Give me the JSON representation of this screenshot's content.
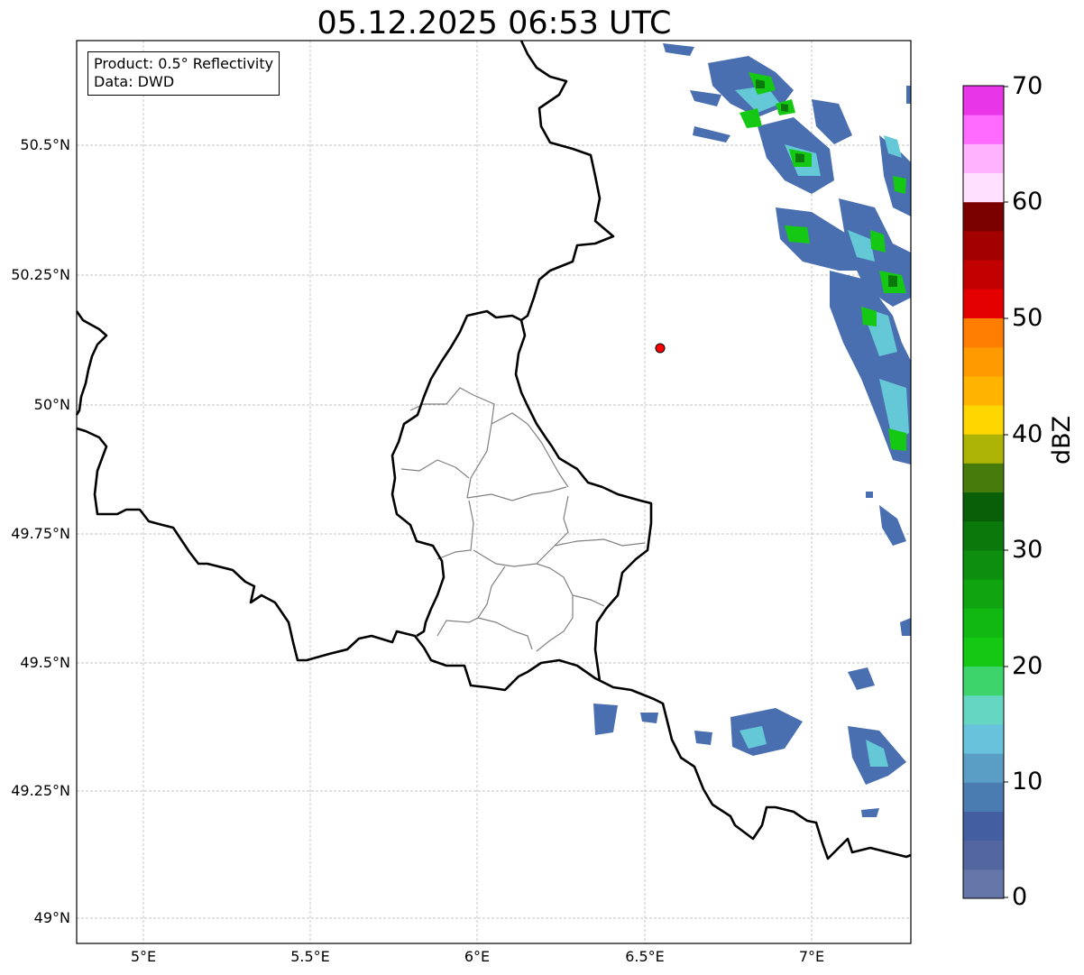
{
  "title": "05.12.2025 06:53 UTC",
  "info": {
    "product": "Product: 0.5° Reflectivity",
    "data_source": "Data: DWD"
  },
  "map": {
    "lon_range": [
      4.8,
      7.3
    ],
    "lat_range": [
      48.95,
      50.7
    ],
    "lat_ticks": [
      "50.5°N",
      "50.25°N",
      "50°N",
      "49.75°N",
      "49.5°N",
      "49.25°N",
      "49°N"
    ],
    "lon_ticks": [
      "5°E",
      "5.5°E",
      "6°E",
      "6.5°E",
      "7°E"
    ],
    "gridlines": true,
    "marker": {
      "lon": 6.55,
      "lat": 50.11,
      "color": "#ff0000"
    }
  },
  "colorbar": {
    "label": "dBZ",
    "ticks": [
      "0",
      "10",
      "20",
      "30",
      "40",
      "50",
      "60",
      "70"
    ],
    "range": [
      0,
      70
    ],
    "colors": [
      "#6477a8",
      "#5466a0",
      "#435fa2",
      "#4a7bb1",
      "#5b9ec5",
      "#67c2dc",
      "#64d6c2",
      "#3ed46c",
      "#14c814",
      "#11b811",
      "#10a410",
      "#0e8e0e",
      "#0b780b",
      "#085f08",
      "#477c0a",
      "#adb405",
      "#ffd700",
      "#ffb400",
      "#ff9a00",
      "#ff7d00",
      "#e50000",
      "#c30000",
      "#a30000",
      "#7b0000",
      "#ffe0ff",
      "#ffb3ff",
      "#ff6bff",
      "#e835e8"
    ]
  }
}
